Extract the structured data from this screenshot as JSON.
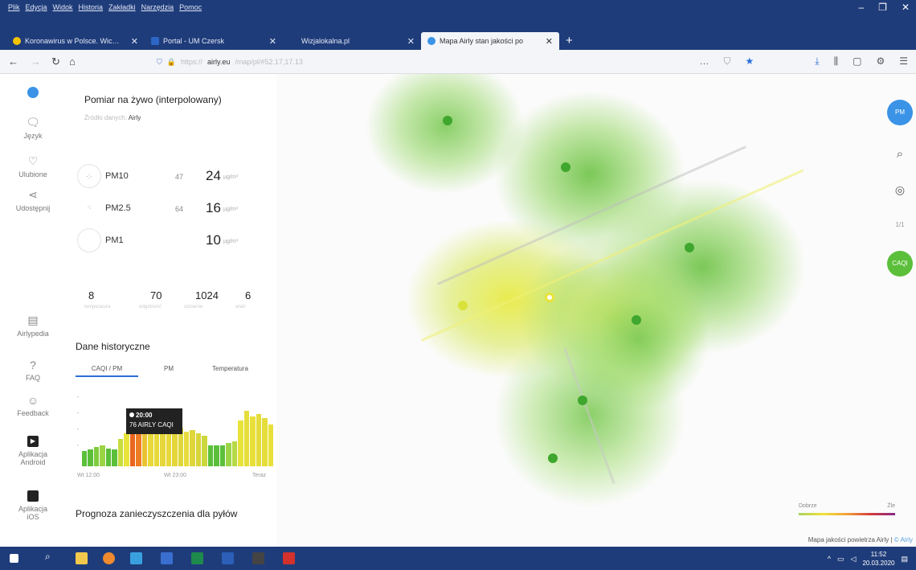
{
  "browser": {
    "menu": [
      "Plik",
      "Edycja",
      "Widok",
      "Historia",
      "Zakładki",
      "Narzędzia",
      "Pomoc"
    ],
    "tabs": [
      {
        "label": "Koronawirus w Polsce. Wiceml",
        "favicon_color": "#f2c300",
        "active": false
      },
      {
        "label": "Portal - UM Czersk",
        "favicon_color": "#2c66c6",
        "active": false
      },
      {
        "label": "Wizjalokalna.pl",
        "favicon_color": "#1f3c7a",
        "active": false
      },
      {
        "label": "Mapa Airly stan jakości po",
        "favicon_color": "#3a93e6",
        "active": true
      }
    ],
    "url": "airly.eu",
    "window_controls": [
      "–",
      "❐",
      "✕"
    ]
  },
  "rail": {
    "items": [
      {
        "label": "",
        "icon": "info-icon"
      },
      {
        "label": "Język",
        "icon": "language-icon"
      },
      {
        "label": "Ulubione",
        "icon": "heart-icon"
      },
      {
        "label": "Udostępnij",
        "icon": "share-icon"
      },
      {
        "label": "Airlypedia",
        "icon": "book-icon"
      },
      {
        "label": "FAQ",
        "icon": "help-icon"
      },
      {
        "label": "Feedback",
        "icon": "feedback-icon"
      },
      {
        "label": "Aplikacja Android",
        "icon": "android-icon"
      },
      {
        "label": "Aplikacja iOS",
        "icon": "ios-icon"
      }
    ]
  },
  "panel": {
    "title": "Pomiar na żywo (interpolowany)",
    "source_label": "Źródło danych:",
    "source_value": "Airly",
    "pollutants": [
      {
        "name": "PM10",
        "percent": "47",
        "value": "24",
        "unit": "µg/m³"
      },
      {
        "name": "PM2.5",
        "percent": "64",
        "value": "16",
        "unit": "µg/m³"
      },
      {
        "name": "PM1",
        "percent": "",
        "value": "10",
        "unit": "µg/m³"
      }
    ],
    "weather": [
      {
        "value": "8",
        "label": "temperatura"
      },
      {
        "value": "70",
        "label": "wilgotność"
      },
      {
        "value": "1024",
        "label": "ciśnienie"
      },
      {
        "value": "6",
        "label": "wiatr"
      }
    ],
    "history_title": "Dane historyczne",
    "history_tabs": [
      "CAQI / PM",
      "PM",
      "Temperatura"
    ],
    "tooltip_time": "20:00",
    "tooltip_value": "76 AIRLY CAQI",
    "x_labels": [
      "Wt 12:00",
      "Wt 23:00",
      "Teraz"
    ],
    "forecast_title": "Prognoza zanieczyszczenia dla pyłów"
  },
  "chart_data": {
    "type": "bar",
    "title": "Dane historyczne",
    "unit": "AIRLY CAQI",
    "x_labels": [
      "Wt 12:00",
      "Wt 23:00",
      "Teraz"
    ],
    "values": [
      22,
      24,
      28,
      30,
      26,
      24,
      40,
      48,
      76,
      72,
      68,
      60,
      64,
      58,
      62,
      60,
      56,
      50,
      52,
      48,
      44,
      30,
      30,
      30,
      34,
      36,
      66,
      80,
      72,
      76,
      70,
      60
    ],
    "colors": [
      "#5bbf3a",
      "#5bbf3a",
      "#7fcc3e",
      "#9bd447",
      "#5bbf3a",
      "#5bbf3a",
      "#c7dd3d",
      "#e8e33a",
      "#e9661f",
      "#ef7c22",
      "#e9c234",
      "#e8d93a",
      "#e8d93a",
      "#e5d63a",
      "#e8d93a",
      "#e5d63a",
      "#ded63a",
      "#e8dc3c",
      "#ded63a",
      "#d8d43a",
      "#ccd73d",
      "#5bbf3a",
      "#5bbf3a",
      "#5bbf3a",
      "#9bd447",
      "#b6d945",
      "#e8e33a",
      "#e5dd3a",
      "#e8e03a",
      "#e3dc3a",
      "#e5dd3a",
      "#e8e03a"
    ],
    "highlight_index": 8,
    "ylim": [
      0,
      100
    ]
  },
  "map": {
    "legend_left": "Dobrze",
    "legend_right": "Źle",
    "credit_text": "Mapa jakości powietrza Airly",
    "credit_link": "© Airly",
    "buttons": [
      "PM",
      "search-icon",
      "locate-icon",
      "1/1",
      "CAQI"
    ]
  },
  "taskbar": {
    "time": "11:52",
    "date": "20.03.2020"
  }
}
